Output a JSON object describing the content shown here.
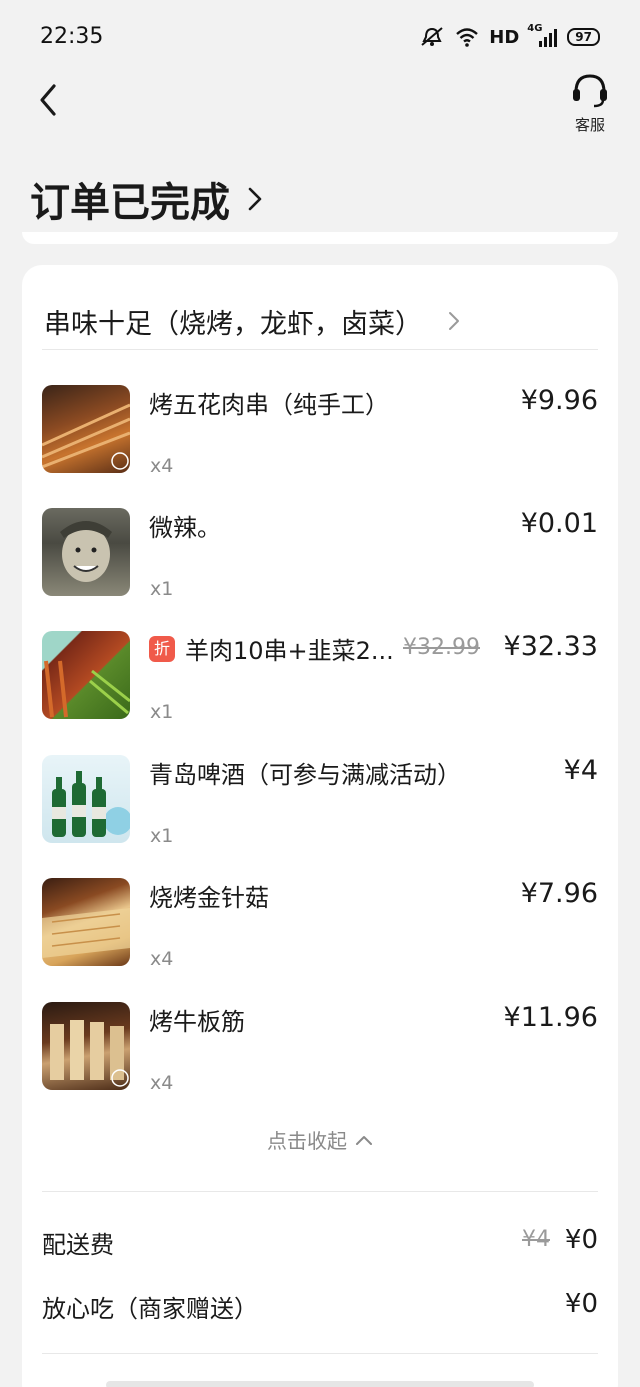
{
  "status": {
    "time": "22:35",
    "hd": "HD",
    "network": "4G",
    "battery": "97"
  },
  "header": {
    "service_label": "客服",
    "title": "订单已完成"
  },
  "store": {
    "name": "串味十足（烧烤，龙虾，卤菜）"
  },
  "items": [
    {
      "name": "烤五花肉串（纯手工）",
      "qty": "x4",
      "price": "¥9.96",
      "image": "grilled-pork-skewers"
    },
    {
      "name": "微辣。",
      "qty": "x1",
      "price": "¥0.01",
      "image": "smiling-man-photo"
    },
    {
      "name": "羊肉10串+韭菜2...",
      "qty": "x1",
      "price": "¥32.33",
      "original_price": "¥32.99",
      "tag": "折",
      "image": "lamb-and-chive-skewers"
    },
    {
      "name": "青岛啤酒（可参与满减活动）",
      "qty": "x1",
      "price": "¥4",
      "image": "beer-bottles"
    },
    {
      "name": "烧烤金针菇",
      "qty": "x4",
      "price": "¥7.96",
      "image": "grilled-enoki"
    },
    {
      "name": "烤牛板筋",
      "qty": "x4",
      "price": "¥11.96",
      "image": "grilled-beef-tendon"
    }
  ],
  "collapse_label": "点击收起",
  "fees": [
    {
      "label": "配送费",
      "original": "¥4",
      "value": "¥0"
    },
    {
      "label": "放心吃（商家赠送）",
      "value": "¥0"
    }
  ],
  "colors": {
    "background": "#f2f2f2",
    "card": "#ffffff",
    "discount_tag": "#f05a4a",
    "muted_text": "#8a8a8a"
  }
}
